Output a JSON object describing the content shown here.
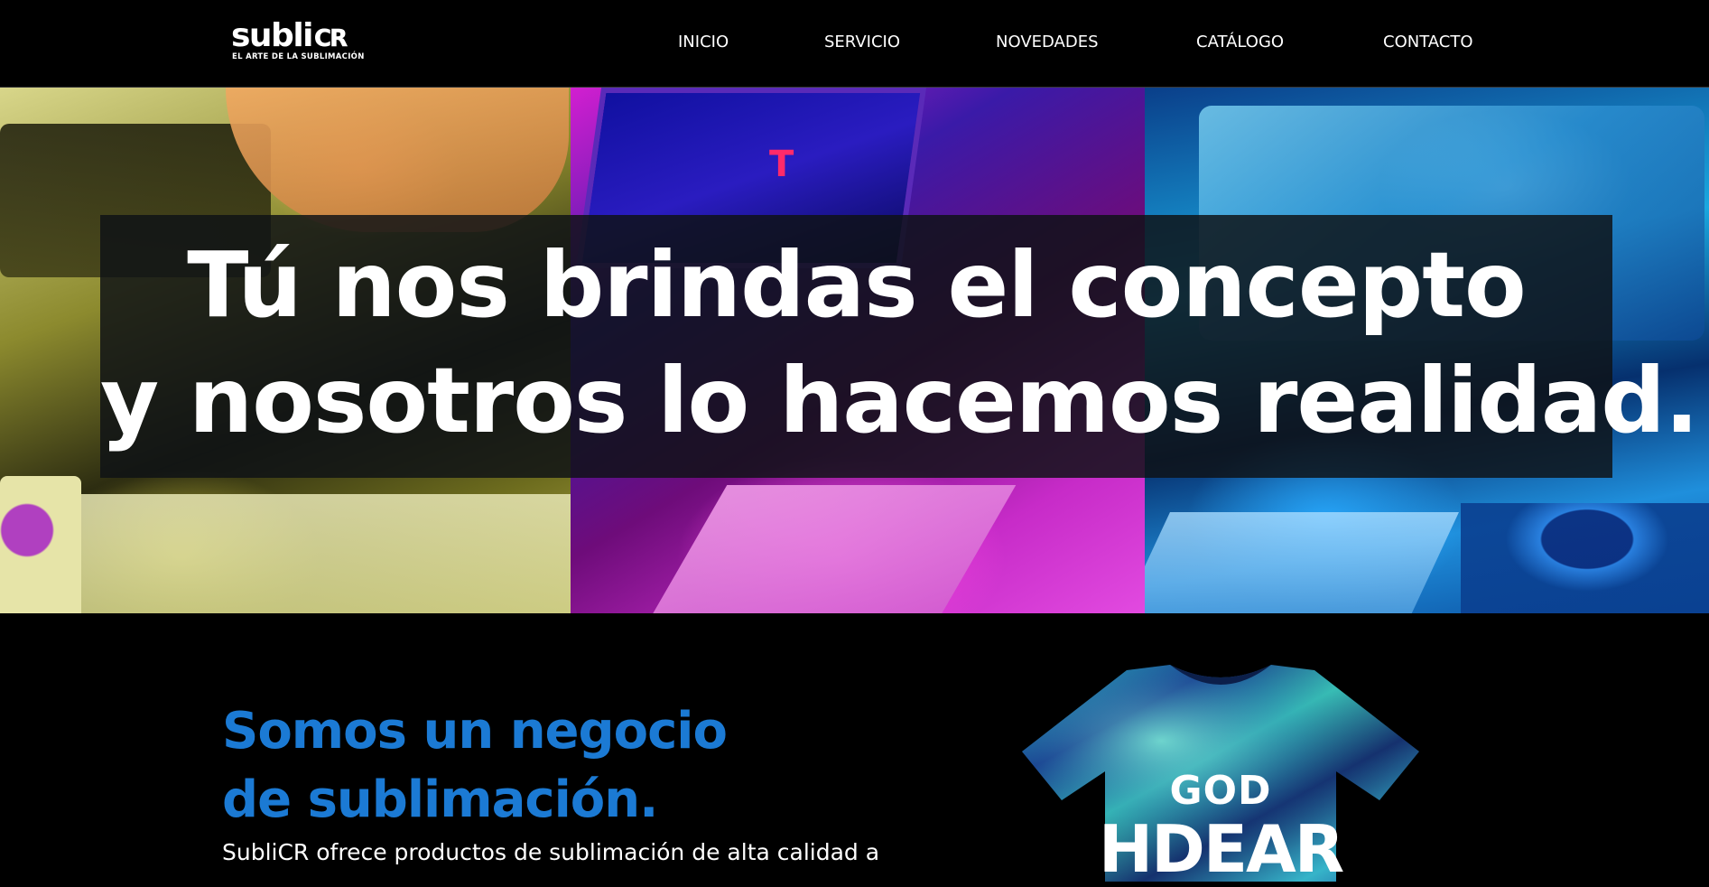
{
  "header": {
    "logo": {
      "word": "subli",
      "mark": "CR",
      "tagline": "EL ARTE DE LA SUBLIMACIÓN"
    },
    "nav": [
      {
        "label": "INICIO"
      },
      {
        "label": "SERVICIO"
      },
      {
        "label": "NOVEDADES"
      },
      {
        "label": "CATÁLOGO"
      },
      {
        "label": "CONTACTO"
      }
    ]
  },
  "hero": {
    "line1": "Tú nos brindas el concepto",
    "line2": "y nosotros lo hacemos realidad.",
    "panel_colors": [
      "#b7b04a",
      "#d21fd0",
      "#1aa8e0"
    ],
    "laptop_logo": "T"
  },
  "about": {
    "title_line1": "Somos un negocio",
    "title_line2": "de sublimación.",
    "description": "SubliCR ofrece productos de sublimación de alta calidad a",
    "title_color": "#1b7ad4",
    "shirt": {
      "text_line1": "GOD",
      "text_line2": "HDEAR"
    }
  }
}
